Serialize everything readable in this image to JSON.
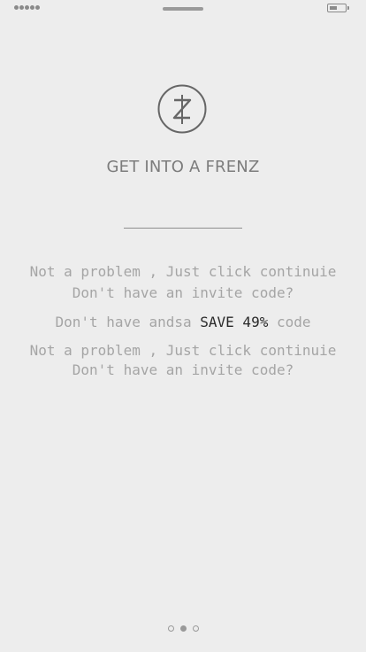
{
  "title": "GET INTO A FRENZ",
  "messages": {
    "line1": "Not a problem , Just click continuie",
    "line2": "Don't have an invite code?",
    "line3_prefix": "Don't have andsa ",
    "line3_promo": "SAVE 49%",
    "line3_suffix": " code",
    "line4": "Not a problem , Just click continuie",
    "line5": "Don't have an invite code?"
  },
  "logo_icon": "frenz-z-logo-icon",
  "pager": {
    "count": 3,
    "active_index": 1
  },
  "colors": {
    "background": "#ededed",
    "text_muted": "#a5a5a5",
    "highlight": "#2a2a2a"
  }
}
